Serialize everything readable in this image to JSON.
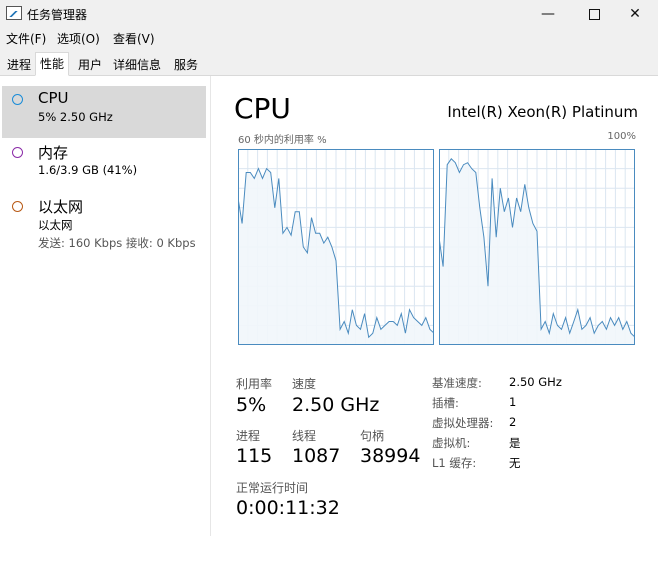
{
  "window": {
    "title": "任务管理器",
    "minimize": "—",
    "close": "✕"
  },
  "menu": [
    "文件(F)",
    "选项(O)",
    "查看(V)"
  ],
  "tabs": [
    "进程",
    "性能",
    "用户",
    "详细信息",
    "服务"
  ],
  "active_tab": "性能",
  "sidebar": {
    "items": [
      {
        "title": "CPU",
        "sub": "5% 2.50 GHz",
        "sub2": "",
        "color": "#1a8cd8"
      },
      {
        "title": "内存",
        "sub": "1.6/3.9 GB (41%)",
        "sub2": "",
        "color": "#8b2ba8"
      },
      {
        "title": "以太网",
        "sub": "以太网",
        "sub2": "发送: 160 Kbps  接收: 0 Kbps",
        "color": "#b85a16"
      }
    ]
  },
  "main": {
    "title": "CPU",
    "model": "Intel(R) Xeon(R) Platinum",
    "graph_label_left": "60 秒内的利用率 %",
    "graph_label_right": "100%"
  },
  "graph_series": {
    "g1": [
      75,
      62,
      88,
      88,
      85,
      90,
      85,
      90,
      88,
      70,
      85,
      57,
      60,
      56,
      68,
      68,
      50,
      47,
      65,
      57,
      57,
      52,
      55,
      50,
      43,
      8,
      12,
      6,
      18,
      10,
      8,
      16,
      4,
      6,
      14,
      8,
      10,
      12,
      12,
      10,
      16,
      6,
      18,
      14,
      12,
      10,
      14,
      8,
      6
    ],
    "g2": [
      55,
      40,
      92,
      95,
      93,
      88,
      92,
      93,
      90,
      88,
      70,
      55,
      30,
      85,
      55,
      80,
      68,
      75,
      60,
      75,
      68,
      82,
      70,
      62,
      58,
      8,
      12,
      6,
      16,
      10,
      8,
      14,
      6,
      12,
      18,
      8,
      10,
      14,
      6,
      10,
      12,
      8,
      14,
      10,
      14,
      8,
      12,
      6,
      4
    ]
  },
  "stats": {
    "util_label": "利用率",
    "util_value": "5%",
    "speed_label": "速度",
    "speed_value": "2.50 GHz",
    "proc_label": "进程",
    "proc_value": "115",
    "thread_label": "线程",
    "thread_value": "1087",
    "handle_label": "句柄",
    "handle_value": "38994",
    "uptime_label": "正常运行时间",
    "uptime_value": "0:00:11:32"
  },
  "info": [
    {
      "label": "基准速度:",
      "value": "2.50 GHz"
    },
    {
      "label": "插槽:",
      "value": "1"
    },
    {
      "label": "虚拟处理器:",
      "value": "2"
    },
    {
      "label": "虚拟机:",
      "value": "是"
    },
    {
      "label": "L1 缓存:",
      "value": "无"
    }
  ],
  "colors": {
    "graph_line": "#4a8bbf",
    "graph_fill": "#f1f6fb",
    "graph_grid": "#dbe6f1"
  }
}
